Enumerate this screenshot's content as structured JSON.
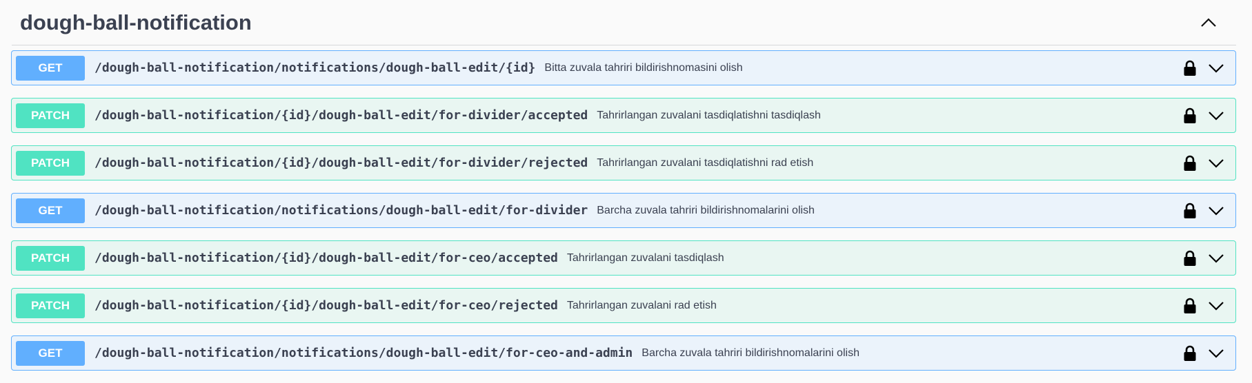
{
  "section": {
    "title": "dough-ball-notification",
    "collapse_icon": "chevron-up-icon"
  },
  "colors": {
    "get": "#61affe",
    "get_bg": "#ebf3fb",
    "patch": "#50e3c2",
    "patch_bg": "#e9f6f2",
    "text": "#3b4151"
  },
  "operations": [
    {
      "method": "GET",
      "path": "/dough-ball-notification/notifications/dough-ball-edit/{id}",
      "summary": "Bitta zuvala tahriri bildirishnomasini olish",
      "locked": true
    },
    {
      "method": "PATCH",
      "path": "/dough-ball-notification/{id}/dough-ball-edit/for-divider/accepted",
      "summary": "Tahrirlangan zuvalani tasdiqlatishni tasdiqlash",
      "locked": true
    },
    {
      "method": "PATCH",
      "path": "/dough-ball-notification/{id}/dough-ball-edit/for-divider/rejected",
      "summary": "Tahrirlangan zuvalani tasdiqlatishni rad etish",
      "locked": true
    },
    {
      "method": "GET",
      "path": "/dough-ball-notification/notifications/dough-ball-edit/for-divider",
      "summary": "Barcha zuvala tahriri bildirishnomalarini olish",
      "locked": true
    },
    {
      "method": "PATCH",
      "path": "/dough-ball-notification/{id}/dough-ball-edit/for-ceo/accepted",
      "summary": "Tahrirlangan zuvalani tasdiqlash",
      "locked": true
    },
    {
      "method": "PATCH",
      "path": "/dough-ball-notification/{id}/dough-ball-edit/for-ceo/rejected",
      "summary": "Tahrirlangan zuvalani rad etish",
      "locked": true
    },
    {
      "method": "GET",
      "path": "/dough-ball-notification/notifications/dough-ball-edit/for-ceo-and-admin",
      "summary": "Barcha zuvala tahriri bildirishnomalarini olish",
      "locked": true
    }
  ]
}
